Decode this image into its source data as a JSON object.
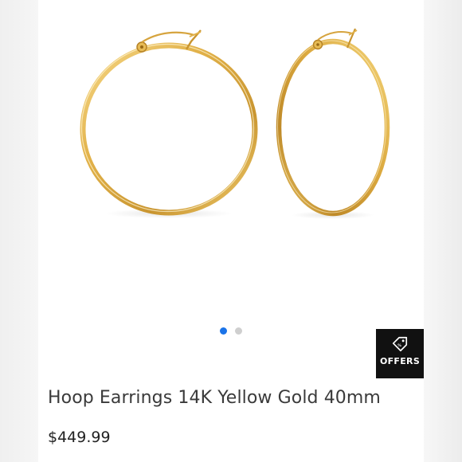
{
  "product": {
    "title": "Hoop Earrings 14K Yellow Gold 40mm",
    "price": "$449.99",
    "image_description_icon": "gold-hoop-earrings-image"
  },
  "gallery": {
    "image_count": 2,
    "active_index": 0,
    "active_dot_color": "#1a73e8",
    "inactive_dot_color": "#cfcfcf"
  },
  "offers_badge": {
    "label": "OFFERS",
    "icon": "price-tag-icon",
    "background": "#111111"
  },
  "colors": {
    "gold": "#d9a93a",
    "gold_highlight": "#f3d47a",
    "gold_shadow": "#b07d1f"
  }
}
